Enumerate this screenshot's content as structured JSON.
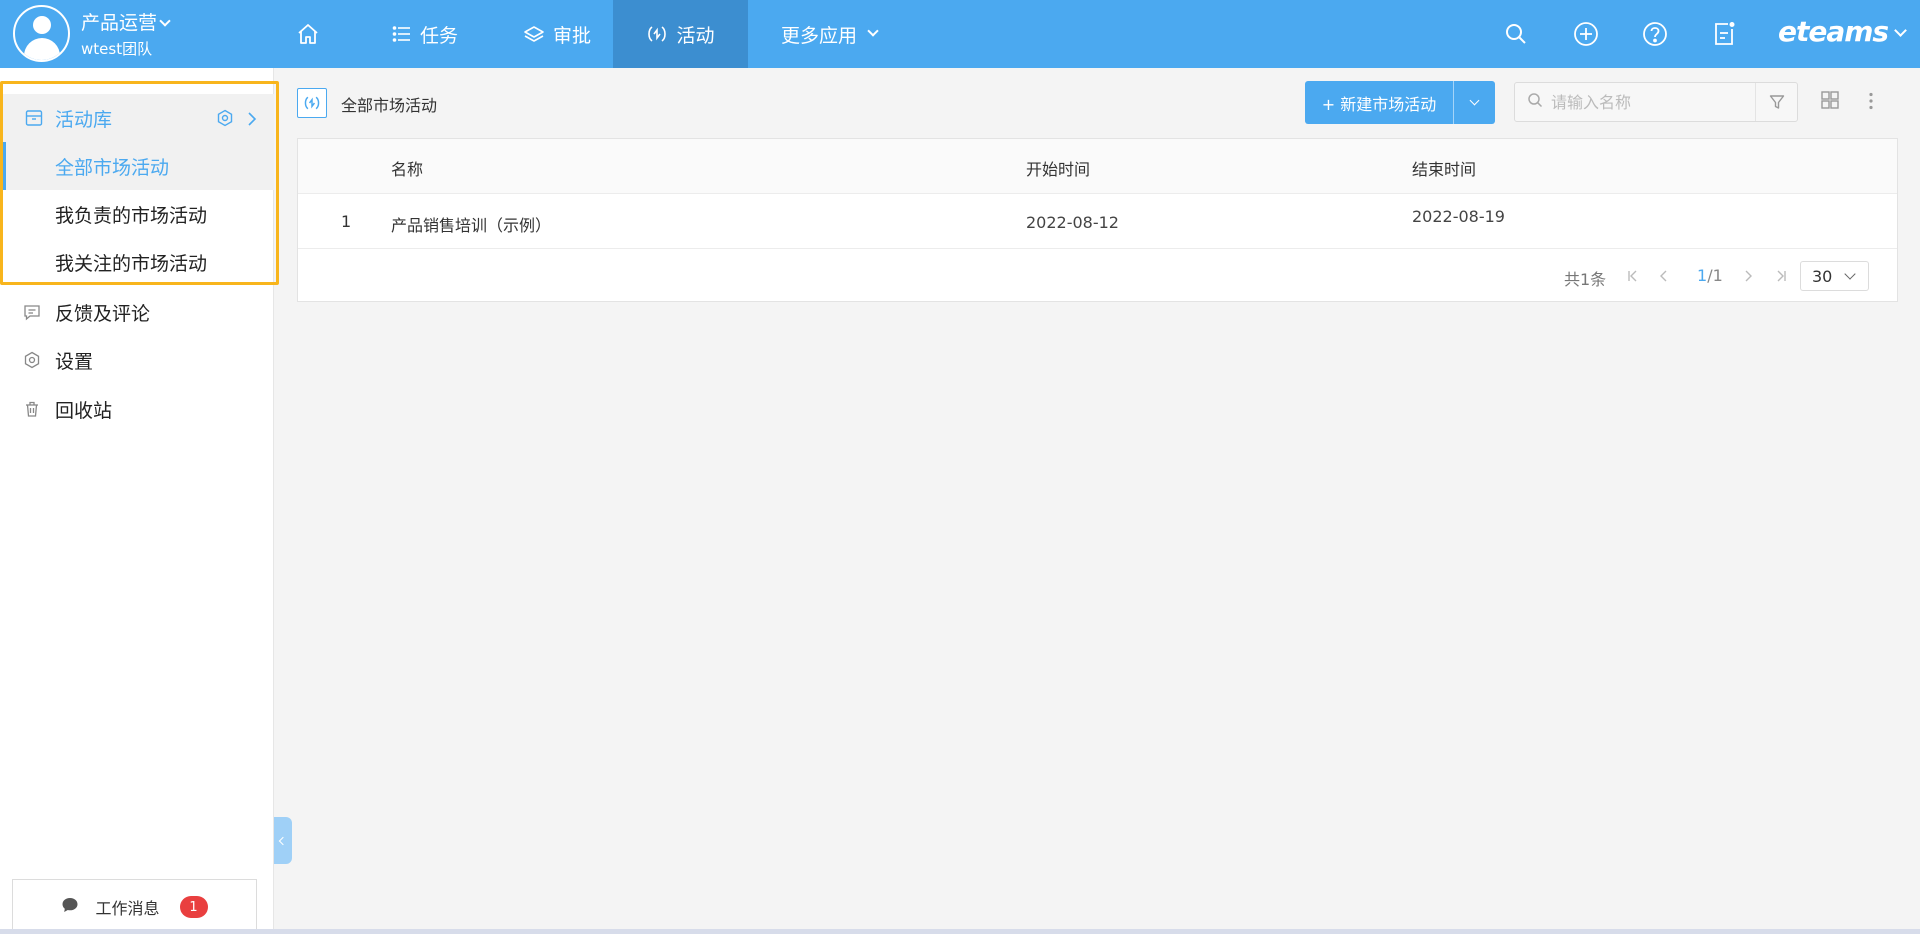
{
  "header": {
    "team_name": "产品运营",
    "team_sub": "wtest团队",
    "nav": {
      "task": "任务",
      "approval": "审批",
      "activity": "活动",
      "more_apps": "更多应用"
    },
    "brand": "eteams",
    "accent_color": "#4ba9f0"
  },
  "sidebar": {
    "library": {
      "label": "活动库",
      "items": [
        {
          "label": "全部市场活动",
          "selected": true
        },
        {
          "label": "我负责的市场活动",
          "selected": false
        },
        {
          "label": "我关注的市场活动",
          "selected": false
        }
      ]
    },
    "menu": [
      {
        "label": "反馈及评论",
        "icon": "comment-icon"
      },
      {
        "label": "设置",
        "icon": "gear-icon"
      },
      {
        "label": "回收站",
        "icon": "trash-icon"
      }
    ],
    "work_message": {
      "label": "工作消息",
      "count": "1"
    }
  },
  "main": {
    "title": "全部市场活动",
    "new_button": "+ 新建市场活动",
    "search_placeholder": "请输入名称",
    "table": {
      "columns": [
        "名称",
        "开始时间",
        "结束时间"
      ],
      "rows": [
        {
          "index": "1",
          "name": "产品销售培训（示例）",
          "start": "2022-08-12",
          "end": "2022-08-19"
        }
      ]
    },
    "pagination": {
      "total": "共1条",
      "current": "1",
      "pages": "/1",
      "page_size": "30"
    }
  }
}
